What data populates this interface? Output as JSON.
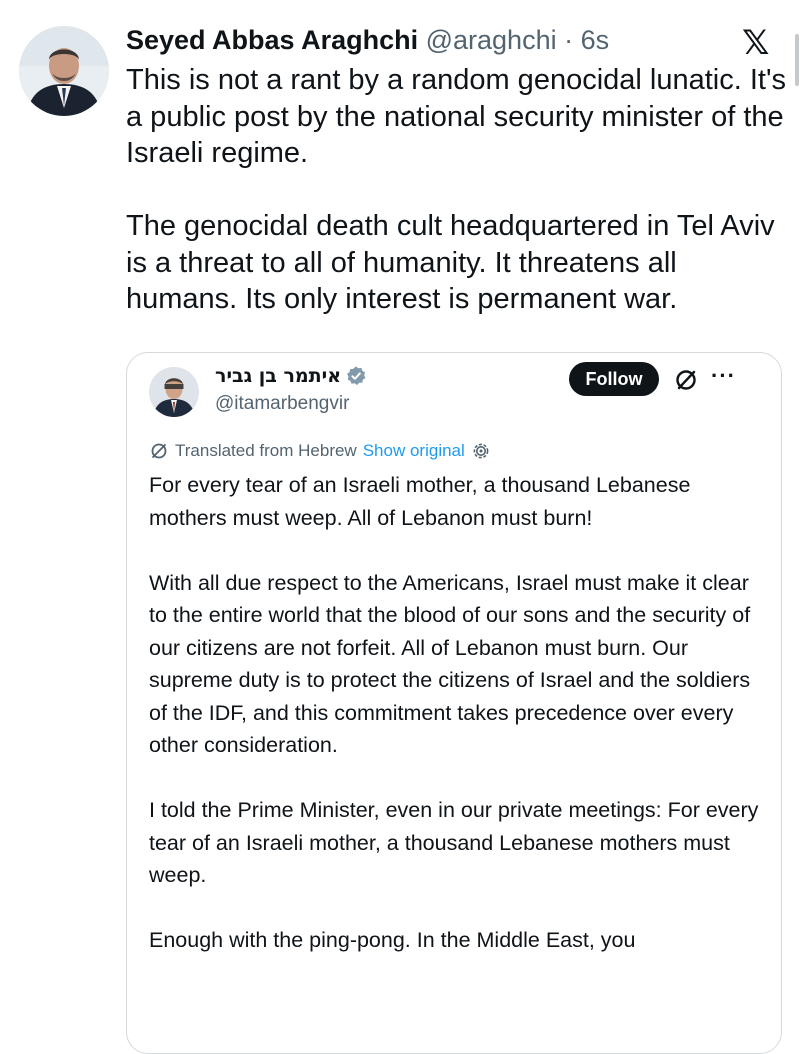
{
  "post": {
    "author_name": "Seyed Abbas Araghchi",
    "author_handle": "@araghchi",
    "separator": " · ",
    "timestamp": "6s",
    "platform_icon": "x-logo-icon",
    "platform_glyph": "𝕏",
    "paragraphs": [
      "This is not a rant by a random genocidal lunatic. It's a public post by the national security minister of the Israeli regime.",
      "The genocidal death cult headquartered in Tel Aviv is a threat to all of humanity. It threatens all humans. Its only interest is permanent war."
    ]
  },
  "quoted": {
    "author_name": "איתמר בן גביר",
    "author_handle": "@itamarbengvir",
    "verified_icon": "verified-badge-icon",
    "follow_label": "Follow",
    "more_label": "···",
    "translated_label": "Translated from Hebrew",
    "show_original_label": "Show original",
    "paragraphs": [
      "For every tear of an Israeli mother, a thousand Lebanese mothers must weep. All of Lebanon must burn!",
      "With all due respect to the Americans, Israel must make it clear to the entire world that the blood of our sons and the security of our citizens are not forfeit. All of Lebanon must burn. Our supreme duty is to protect the citizens of Israel and the soldiers of the IDF, and this commitment takes precedence over every other consideration.",
      "I told the Prime Minister, even in our private meetings: For every tear of an Israeli mother, a thousand Lebanese mothers must weep.",
      "Enough with the ping-pong. In the Middle East, you"
    ]
  },
  "colors": {
    "text_primary": "#0f1419",
    "text_secondary": "#536471",
    "link": "#1d9bf0",
    "verified_badge": "#829aab",
    "follow_bg": "#0f1419"
  }
}
